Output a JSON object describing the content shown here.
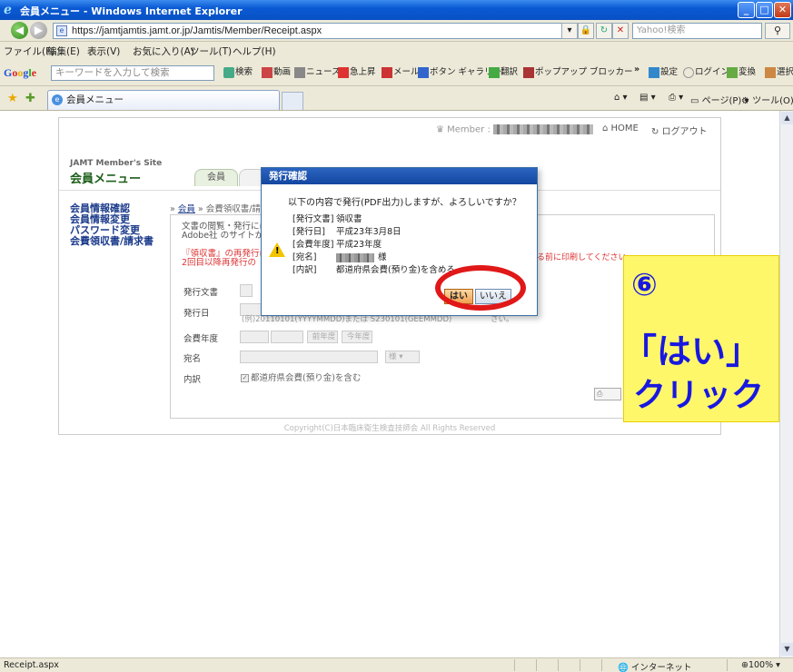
{
  "window": {
    "title": "会員メニュー - Windows Internet Explorer"
  },
  "address": {
    "url": "https://jamtjamtis.jamt.or.jp/Jamtis/Member/Receipt.aspx",
    "search_placeholder": "Yahoo!検索"
  },
  "menu": [
    "ファイル(F)",
    "編集(E)",
    "表示(V)",
    "お気に入り(A)",
    "ツール(T)",
    "ヘルプ(H)"
  ],
  "google": {
    "logo": "Google",
    "placeholder": "キーワードを入力して検索",
    "search_label": "検索",
    "items": [
      "動画",
      "ニュース",
      "急上昇",
      "メール",
      "ボタン ギャラリー",
      "翻訳",
      "ポップアップ ブロッカー",
      "»",
      "設定",
      "ログイン",
      "変換",
      "選択"
    ]
  },
  "tab": {
    "label": "会員メニュー"
  },
  "tools": {
    "page": "ページ(P)",
    "tools": "ツール(O)"
  },
  "site": {
    "member_label": "Member :",
    "home": "HOME",
    "logout": "ログアウト",
    "brand_sub": "JAMT Member's Site",
    "brand_main": "会員メニュー",
    "tab_label": "会員",
    "side": [
      "会員情報確認",
      "会員情報変更",
      "パスワード変更",
      "会費領収書/請求書"
    ],
    "crumb_prefix": "»",
    "crumb_link": "会員",
    "crumb_rest": "» 会費領収書/請",
    "desc_1": "文書の閲覧・発行には",
    "desc_2": "Adobe社 のサイトから",
    "warn_1": "『領収書』の再発行は",
    "warn_2": "2回目以降再発行の",
    "warn_right": "場る前に印刷してください。",
    "fields": {
      "doc_label": "発行文書",
      "date_label": "発行日",
      "date_hint": "(例)20110101(YYYYMMDD)または S230101(GEEMMDD)",
      "date_hint_tail": "さい。",
      "year_label": "会費年度",
      "year_btn_1": "前年度",
      "year_btn_2": "今年度",
      "addr_label": "宛名",
      "addr_suffix": "様",
      "detail_label": "内訳",
      "detail_check": "都道府県会費(預り金)を含む"
    },
    "copyright": "Copyright(C)日本臨床衛生検査技師会 All Rights Reserved"
  },
  "dialog": {
    "title": "発行確認",
    "message": "以下の内容で発行(PDF出力)しますが、よろしいですか？",
    "rows": [
      {
        "key": "[発行文書]",
        "value": "領収書"
      },
      {
        "key": "[発行日]",
        "value": "平成23年3月8日"
      },
      {
        "key": "[会費年度]",
        "value": "平成23年度"
      },
      {
        "key": "[宛名]",
        "value": "様"
      },
      {
        "key": "[内訳]",
        "value": "都道府県会費(預り金)を含める"
      }
    ],
    "yes": "はい",
    "no": "いいえ"
  },
  "callout": {
    "number": "⑥",
    "line1": "「はい」",
    "line2": "クリック"
  },
  "status": {
    "left": "Receipt.aspx",
    "zone": "インターネット",
    "zoom": "100%"
  }
}
